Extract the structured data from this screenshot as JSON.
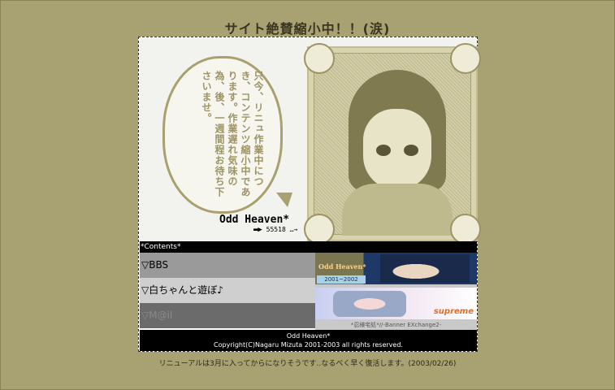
{
  "site": {
    "title": "サイト絶賛縮小中！！(涙)",
    "message": "只今、リニュ作業中につき、コンテンツ縮小中であります。作業遅れ気味の為、後、一週間程お待ち下さいませ。",
    "logo": "Odd Heaven*",
    "counter": "55518"
  },
  "contents": {
    "label": "*Contents*",
    "items": [
      {
        "label": "▽BBS"
      },
      {
        "label": "▽白ちゃんと遊ぼ♪"
      },
      {
        "label": "▽M@il"
      }
    ]
  },
  "banners": {
    "banner1_logo": "Odd Heaven*",
    "banner1_years": "2001~2002",
    "banner2_logo": "supreme",
    "caption": "*忍様宅処*//-Banner EXchange2-"
  },
  "footer": {
    "line1": "Odd Heaven*",
    "line2": "Copyright(C)Nagaru Mizuta 2001-2003 all rights reserved."
  },
  "note": "リニューアルは3月に入ってからになりそうです‥なるべく早く復活します。(2003/02/26)",
  "colors": {
    "page_bg": "#a8a172",
    "accent": "#9c9466",
    "dark_bar": "#000000"
  }
}
